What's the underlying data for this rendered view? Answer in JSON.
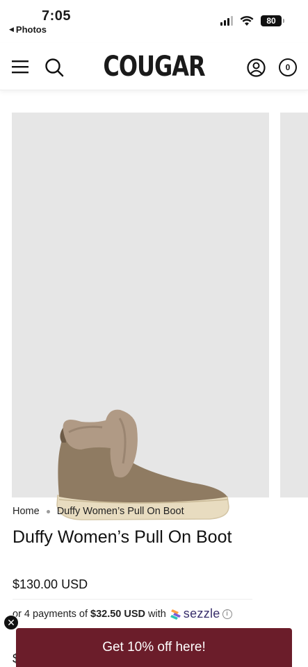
{
  "status_bar": {
    "time": "7:05",
    "back_app": "Photos",
    "battery": "80"
  },
  "header": {
    "logo": "COUGAR",
    "cart_count": "0",
    "icons": [
      "menu-icon",
      "search-icon",
      "account-icon",
      "cart-icon"
    ]
  },
  "breadcrumb": {
    "home": "Home",
    "current": "Duffy Women’s Pull On Boot"
  },
  "product": {
    "title": "Duffy Women’s Pull On Boot",
    "price": "$130.00 USD"
  },
  "installments": {
    "prefix": "or 4 payments of",
    "amount": "$32.50 USD",
    "with": "with",
    "provider": "sezzle"
  },
  "promo": {
    "label": "Get 10% off here!",
    "close_symbol": "✕"
  },
  "peek_text": "$",
  "colors": {
    "promo_bg": "#6b1d2a",
    "gallery_bg": "#e6e6e6",
    "sezzle_text": "#382e6b"
  }
}
